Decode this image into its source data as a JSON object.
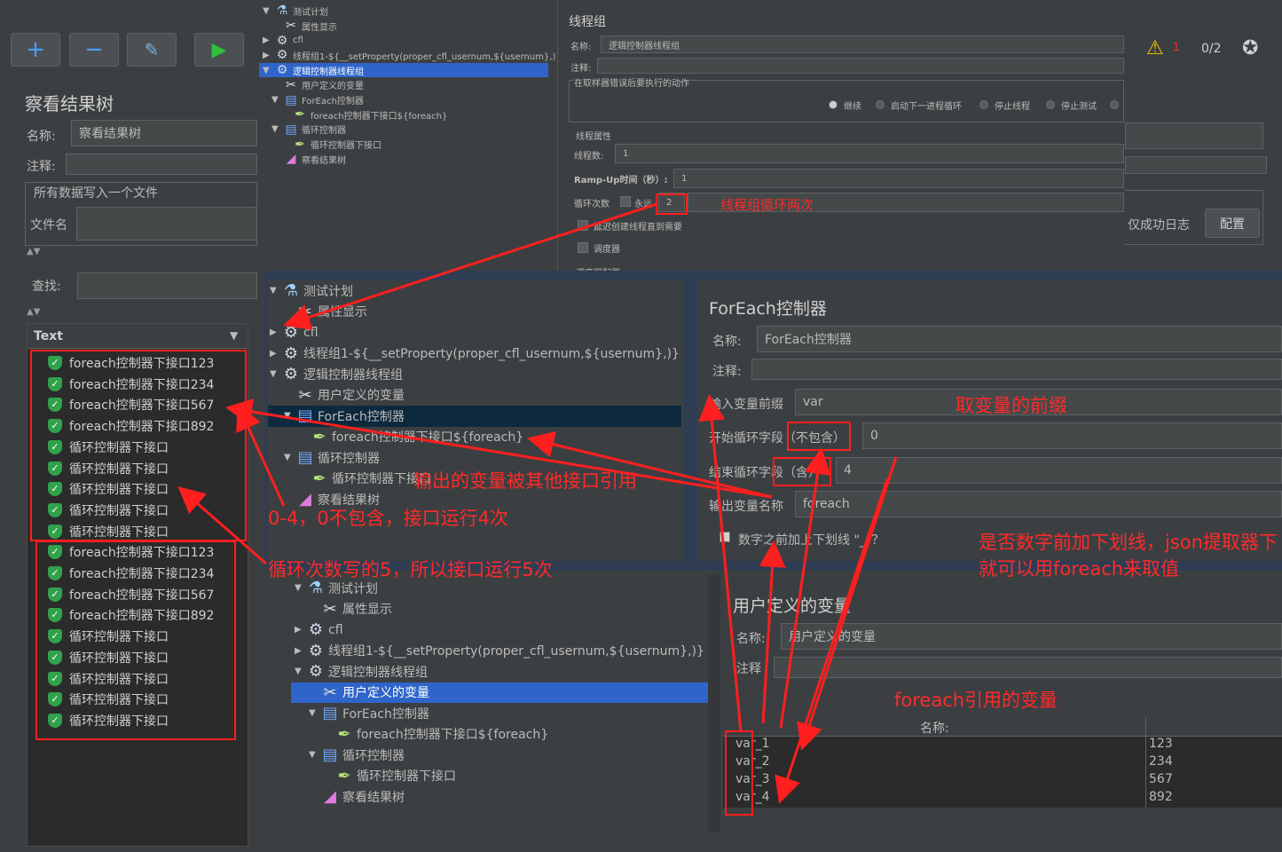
{
  "toolbar": {
    "add_icon": "+",
    "remove_icon": "−",
    "warning_count": "1",
    "thread_count": "0/2"
  },
  "result_tree": {
    "title": "察看结果树",
    "name_label": "名称:",
    "name_value": "察看结果树",
    "comment_label": "注释:",
    "write_all_label": "所有数据写入一个文件",
    "filename_label": "文件名",
    "success_log_label": "仅成功日志",
    "config_button": "配置",
    "search_label": "查找:",
    "column_header": "Text",
    "results_group1": [
      "foreach控制器下接口123",
      "foreach控制器下接口234",
      "foreach控制器下接口567",
      "foreach控制器下接口892",
      "循环控制器下接口",
      "循环控制器下接口",
      "循环控制器下接口",
      "循环控制器下接口",
      "循环控制器下接口"
    ],
    "results_group2": [
      "foreach控制器下接口123",
      "foreach控制器下接口234",
      "foreach控制器下接口567",
      "foreach控制器下接口892",
      "循环控制器下接口",
      "循环控制器下接口",
      "循环控制器下接口",
      "循环控制器下接口",
      "循环控制器下接口"
    ]
  },
  "top_tree": {
    "items": [
      "测试计划",
      "属性显示",
      "cfl",
      "线程组1-${__setProperty(proper_cfl_usernum,${usernum},)}",
      "逻辑控制器线程组",
      "用户定义的变量",
      "ForEach控制器",
      "foreach控制器下接口${foreach}",
      "循环控制器",
      "循环控制器下接口",
      "察看结果树"
    ]
  },
  "thread_group": {
    "title": "线程组",
    "name_label": "名称:",
    "name_value": "逻辑控制器线程组",
    "comment_label": "注释:",
    "error_action_label": "在取样器错误后要执行的动作",
    "actions": [
      "继续",
      "启动下一进程循环",
      "停止线程",
      "停止测试"
    ],
    "props_label": "线程属性",
    "threads_label": "线程数:",
    "threads_value": "1",
    "rampup_label": "Ramp-Up时间（秒）:",
    "rampup_value": "1",
    "loop_label": "循环次数",
    "forever_label": "永远",
    "loop_value": "2",
    "delay_label": "延迟创建线程直到需要",
    "scheduler_label": "调度器",
    "scheduler_config_label": "调度器配置"
  },
  "mid_tree": {
    "items": [
      "测试计划",
      "属性显示",
      "cfl",
      "线程组1-${__setProperty(proper_cfl_usernum,${usernum},)}",
      "逻辑控制器线程组",
      "用户定义的变量",
      "ForEach控制器",
      "foreach控制器下接口${foreach}",
      "循环控制器",
      "循环控制器下接口",
      "察看结果树"
    ]
  },
  "foreach": {
    "title": "ForEach控制器",
    "name_label": "名称:",
    "name_value": "ForEach控制器",
    "comment_label": "注释:",
    "input_prefix_label": "输入变量前缀",
    "input_prefix_value": "var",
    "start_label": "开始循环字段（不包含）",
    "start_value": "0",
    "end_label": "结束循环字段（含）",
    "end_value": "4",
    "output_label": "输出变量名称",
    "output_value": "foreach",
    "underscore_label": "数字之前加上下划线 \"_\"？"
  },
  "bottom_tree": {
    "items": [
      "测试计划",
      "属性显示",
      "cfl",
      "线程组1-${__setProperty(proper_cfl_usernum,${usernum},)}",
      "逻辑控制器线程组",
      "用户定义的变量",
      "ForEach控制器",
      "foreach控制器下接口${foreach}",
      "循环控制器",
      "循环控制器下接口",
      "察看结果树"
    ]
  },
  "udv": {
    "title": "用户定义的变量",
    "name_label": "名称:",
    "name_value": "用户定义的变量",
    "comment_label": "注释",
    "col_name": "名称:",
    "rows": [
      {
        "name": "var_1",
        "value": "123"
      },
      {
        "name": "var_2",
        "value": "234"
      },
      {
        "name": "var_3",
        "value": "567"
      },
      {
        "name": "var_4",
        "value": "892"
      }
    ]
  },
  "annotations": {
    "loop_twice": "线程组循环两次",
    "prefix": "取变量的前缀",
    "output_ref": "输出的变量被其他接口引用",
    "range": "0-4，0不包含，接口运行4次",
    "loop_five": "循环次数写的5，所以接口运行5次",
    "underscore1": "是否数字前加下划线，json提取器下",
    "underscore2": "就可以用foreach来取值",
    "vars_ref": "foreach引用的变量"
  },
  "colors": {
    "annotation_red": "#ff1f1f",
    "selection_blue": "#2f65ca",
    "bg": "#3c3f41"
  }
}
